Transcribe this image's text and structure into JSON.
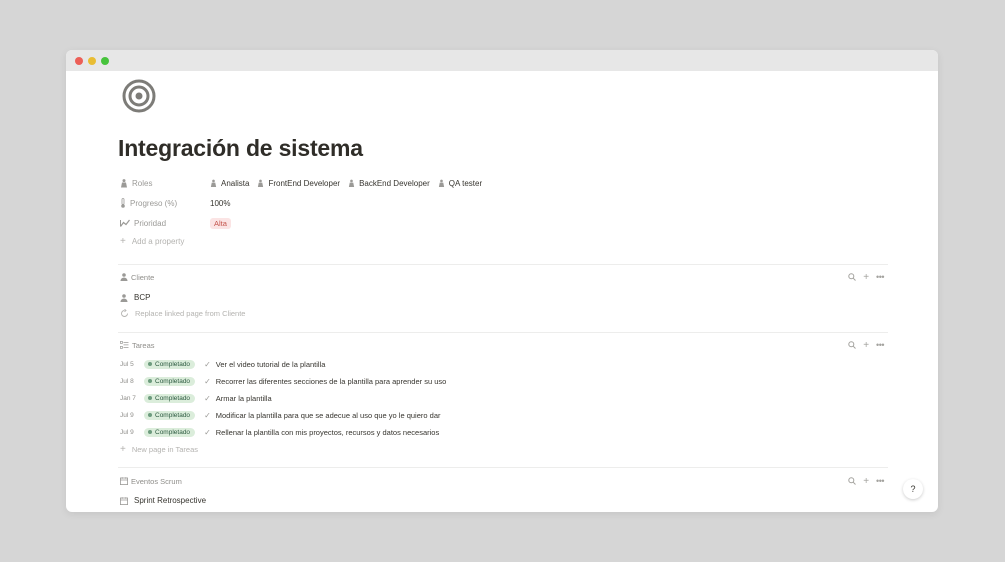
{
  "window": {
    "controls": [
      "close",
      "minimize",
      "maximize"
    ],
    "colors": {
      "close": "#ec5f57",
      "minimize": "#e9bd34",
      "maximize": "#47c33c"
    }
  },
  "page": {
    "icon": "target-icon",
    "title": "Integración de sistema"
  },
  "properties": {
    "roles": {
      "label": "Roles",
      "icon": "person-icon",
      "values": [
        "Analista",
        "FrontEnd Developer",
        "BackEnd Developer",
        "QA tester"
      ]
    },
    "progreso": {
      "label": "Progreso (%)",
      "icon": "thermometer-icon",
      "value": "100%"
    },
    "prioridad": {
      "label": "Prioridad",
      "icon": "trend-icon",
      "value": "Alta",
      "tag_color": "#fbe4e4"
    },
    "add_label": "Add a property"
  },
  "cliente": {
    "title": "Cliente",
    "item": "BCP",
    "replace_label": "Replace linked page from Cliente"
  },
  "tareas": {
    "title": "Tareas",
    "rows": [
      {
        "date": "Jul 5",
        "status": "Completado",
        "name": "Ver el video tutorial de la plantilla"
      },
      {
        "date": "Jul 8",
        "status": "Completado",
        "name": "Recorrer las diferentes secciones de la plantilla para aprender su uso"
      },
      {
        "date": "Jan 7",
        "status": "Completado",
        "name": "Armar la plantilla"
      },
      {
        "date": "Jul 9",
        "status": "Completado",
        "name": "Modificar la plantilla para que se adecue al uso que yo le quiero dar"
      },
      {
        "date": "Jul 9",
        "status": "Completado",
        "name": "Rellenar la plantilla con mis proyectos, recursos y datos necesarios"
      }
    ],
    "new_label": "New page in Tareas",
    "status_color": "#dbeddb"
  },
  "eventos": {
    "title": "Eventos Scrum",
    "item": "Sprint Retrospective"
  },
  "section_actions": {
    "search": "search-icon",
    "add": "plus-icon",
    "more": "more-icon"
  },
  "help": {
    "label": "?"
  }
}
